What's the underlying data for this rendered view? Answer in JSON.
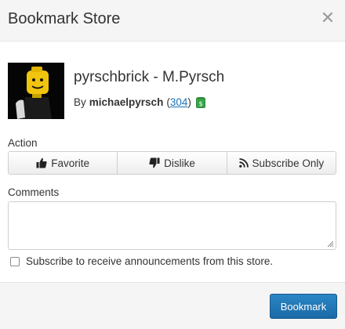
{
  "dialog": {
    "title": "Bookmark Store"
  },
  "store": {
    "name": "pyrschbrick - M.Pyrsch",
    "by_label": "By",
    "author": "michaelpyrsch",
    "count_open": "(",
    "count": "304",
    "count_close": ")",
    "money_icon": "money-icon"
  },
  "action": {
    "label": "Action",
    "buttons": [
      {
        "label": "Favorite",
        "icon": "thumbs-up-icon"
      },
      {
        "label": "Dislike",
        "icon": "thumbs-down-icon"
      },
      {
        "label": "Subscribe Only",
        "icon": "rss-icon"
      }
    ]
  },
  "comments": {
    "label": "Comments",
    "value": ""
  },
  "subscribe": {
    "label": "Subscribe to receive announcements from this store.",
    "checked": false
  },
  "footer": {
    "submit_label": "Bookmark"
  },
  "colors": {
    "primary": "#1f77bb",
    "link": "#1a73b8",
    "money": "#3aa54a"
  }
}
